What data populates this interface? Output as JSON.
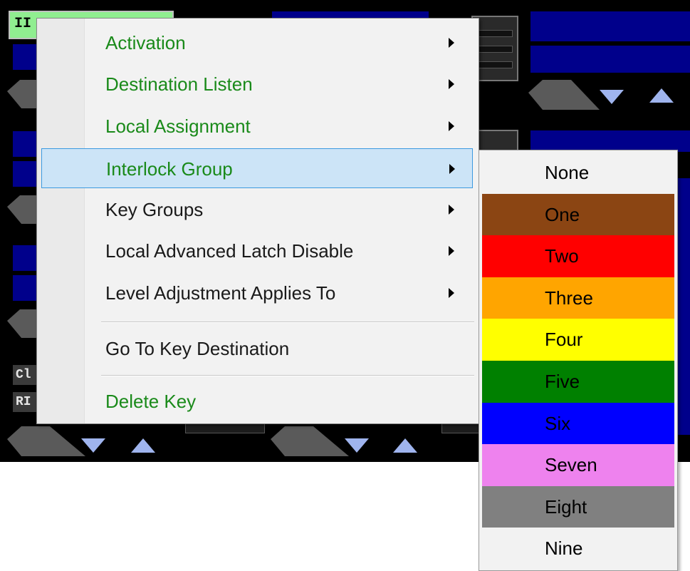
{
  "background": {
    "top_left_label": "II",
    "side_labels": [
      "Cl",
      "RI"
    ]
  },
  "context_menu": {
    "items": [
      {
        "label": "Activation",
        "has_submenu": true,
        "color": "#1a8a1a",
        "highlighted": false
      },
      {
        "label": "Destination Listen",
        "has_submenu": true,
        "color": "#1a8a1a",
        "highlighted": false
      },
      {
        "label": "Local Assignment",
        "has_submenu": true,
        "color": "#1a8a1a",
        "highlighted": false
      },
      {
        "label": "Interlock Group",
        "has_submenu": true,
        "color": "#1a8a1a",
        "highlighted": true
      },
      {
        "label": "Key Groups",
        "has_submenu": true,
        "color": "#1a1a1a",
        "highlighted": false
      },
      {
        "label": "Local Advanced Latch Disable",
        "has_submenu": true,
        "color": "#1a1a1a",
        "highlighted": false
      },
      {
        "label": "Level Adjustment Applies To",
        "has_submenu": true,
        "color": "#1a1a1a",
        "highlighted": false
      },
      {
        "label": "Go To Key Destination",
        "has_submenu": false,
        "color": "#1a1a1a",
        "highlighted": false
      },
      {
        "label": "Delete Key",
        "has_submenu": false,
        "color": "#1a8a1a",
        "highlighted": false
      }
    ]
  },
  "interlock_submenu": {
    "items": [
      {
        "label": "None",
        "bg": "#f2f2f2",
        "fg": "#000000"
      },
      {
        "label": "One",
        "bg": "#8b4513",
        "fg": "#000000"
      },
      {
        "label": "Two",
        "bg": "#ff0000",
        "fg": "#000000"
      },
      {
        "label": "Three",
        "bg": "#ffa500",
        "fg": "#000000"
      },
      {
        "label": "Four",
        "bg": "#ffff00",
        "fg": "#000000"
      },
      {
        "label": "Five",
        "bg": "#008000",
        "fg": "#000000"
      },
      {
        "label": "Six",
        "bg": "#0000ff",
        "fg": "#000000"
      },
      {
        "label": "Seven",
        "bg": "#ee82ee",
        "fg": "#000000"
      },
      {
        "label": "Eight",
        "bg": "#808080",
        "fg": "#000000"
      },
      {
        "label": "Nine",
        "bg": "#f2f2f2",
        "fg": "#000000"
      }
    ]
  }
}
